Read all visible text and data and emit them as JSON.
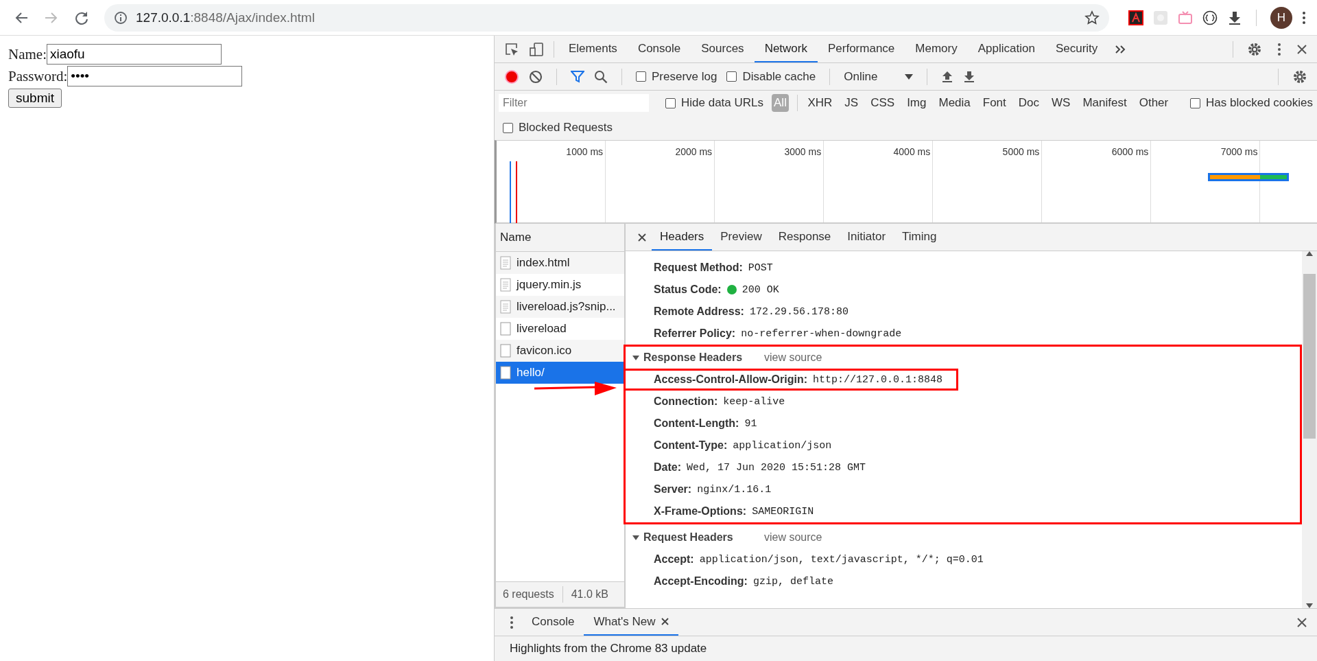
{
  "browser": {
    "url_host": "127.0.0.1",
    "url_path": ":8848/Ajax/index.html",
    "forward_disabled": true,
    "avatar": "H"
  },
  "page": {
    "fields": [
      {
        "label": "Name:",
        "value": "xiaofu"
      },
      {
        "label": "Password:",
        "value": "••••"
      }
    ],
    "submit": "submit"
  },
  "devtools": {
    "tabs": [
      {
        "label": "Elements",
        "selected": false
      },
      {
        "label": "Console",
        "selected": false
      },
      {
        "label": "Sources",
        "selected": false
      },
      {
        "label": "Network",
        "selected": true
      },
      {
        "label": "Performance",
        "selected": false
      },
      {
        "label": "Memory",
        "selected": false
      },
      {
        "label": "Application",
        "selected": false
      },
      {
        "label": "Security",
        "selected": false
      }
    ],
    "toolbar": {
      "recording": true,
      "filter_shown": true,
      "options": [
        {
          "label": "Preserve log",
          "checked": false
        },
        {
          "label": "Disable cache",
          "checked": false
        }
      ],
      "throttle": "Online"
    },
    "filter": {
      "placeholder": "Filter",
      "hide_data_urls": {
        "label": "Hide data URLs",
        "checked": false
      },
      "types": [
        {
          "label": "All",
          "selected": true
        },
        {
          "label": "XHR",
          "selected": false
        },
        {
          "label": "JS",
          "selected": false
        },
        {
          "label": "CSS",
          "selected": false
        },
        {
          "label": "Img",
          "selected": false
        },
        {
          "label": "Media",
          "selected": false
        },
        {
          "label": "Font",
          "selected": false
        },
        {
          "label": "Doc",
          "selected": false
        },
        {
          "label": "WS",
          "selected": false
        },
        {
          "label": "Manifest",
          "selected": false
        },
        {
          "label": "Other",
          "selected": false
        }
      ],
      "has_blocked_cookies": {
        "label": "Has blocked cookies",
        "checked": false
      },
      "blocked_requests": {
        "label": "Blocked Requests",
        "checked": false
      }
    },
    "timeline": {
      "ticks": [
        "1000 ms",
        "2000 ms",
        "3000 ms",
        "4000 ms",
        "5000 ms",
        "6000 ms",
        "7000 ms"
      ]
    },
    "requests": {
      "column": "Name",
      "items": [
        {
          "name": "index.html",
          "kind": "document",
          "selected": false
        },
        {
          "name": "jquery.min.js",
          "kind": "document",
          "selected": false
        },
        {
          "name": "livereload.js?snip...",
          "kind": "document",
          "selected": false
        },
        {
          "name": "livereload",
          "kind": "blank",
          "selected": false
        },
        {
          "name": "favicon.ico",
          "kind": "blank",
          "selected": false
        },
        {
          "name": "hello/",
          "kind": "blank",
          "selected": true
        }
      ],
      "count": "6 requests",
      "size": "41.0 kB"
    },
    "details": {
      "tabs": [
        {
          "label": "Headers",
          "selected": true
        },
        {
          "label": "Preview",
          "selected": false
        },
        {
          "label": "Response",
          "selected": false
        },
        {
          "label": "Initiator",
          "selected": false
        },
        {
          "label": "Timing",
          "selected": false
        }
      ],
      "general": [
        {
          "label": "Request Method:",
          "value": "POST"
        },
        {
          "label": "Status Code:",
          "value": "200 OK",
          "color": "#1fb141"
        },
        {
          "label": "Remote Address:",
          "value": "172.29.56.178:80"
        },
        {
          "label": "Referrer Policy:",
          "value": "no-referrer-when-downgrade"
        }
      ],
      "sections": [
        {
          "title": "Response Headers",
          "link": "view source",
          "expanded": true,
          "highlighted": true,
          "headers": [
            {
              "label": "Access-Control-Allow-Origin:",
              "value": "http://127.0.0.1:8848",
              "highlighted": true
            },
            {
              "label": "Connection:",
              "value": "keep-alive",
              "highlighted": false
            },
            {
              "label": "Content-Length:",
              "value": "91",
              "highlighted": false
            },
            {
              "label": "Content-Type:",
              "value": "application/json",
              "highlighted": false
            },
            {
              "label": "Date:",
              "value": "Wed, 17 Jun 2020 15:51:28 GMT",
              "highlighted": false
            },
            {
              "label": "Server:",
              "value": "nginx/1.16.1",
              "highlighted": false
            },
            {
              "label": "X-Frame-Options:",
              "value": "SAMEORIGIN",
              "highlighted": false
            }
          ]
        },
        {
          "title": "Request Headers",
          "link": "view source",
          "expanded": true,
          "highlighted": false,
          "headers": [
            {
              "label": "Accept:",
              "value": "application/json, text/javascript, */*; q=0.01",
              "highlighted": false
            },
            {
              "label": "Accept-Encoding:",
              "value": "gzip, deflate",
              "highlighted": false
            }
          ]
        }
      ]
    }
  },
  "drawer": {
    "tabs": [
      {
        "label": "Console",
        "selected": false,
        "closable": false
      },
      {
        "label": "What's New",
        "selected": true,
        "closable": true
      }
    ],
    "content": "Highlights from the Chrome 83 update"
  }
}
